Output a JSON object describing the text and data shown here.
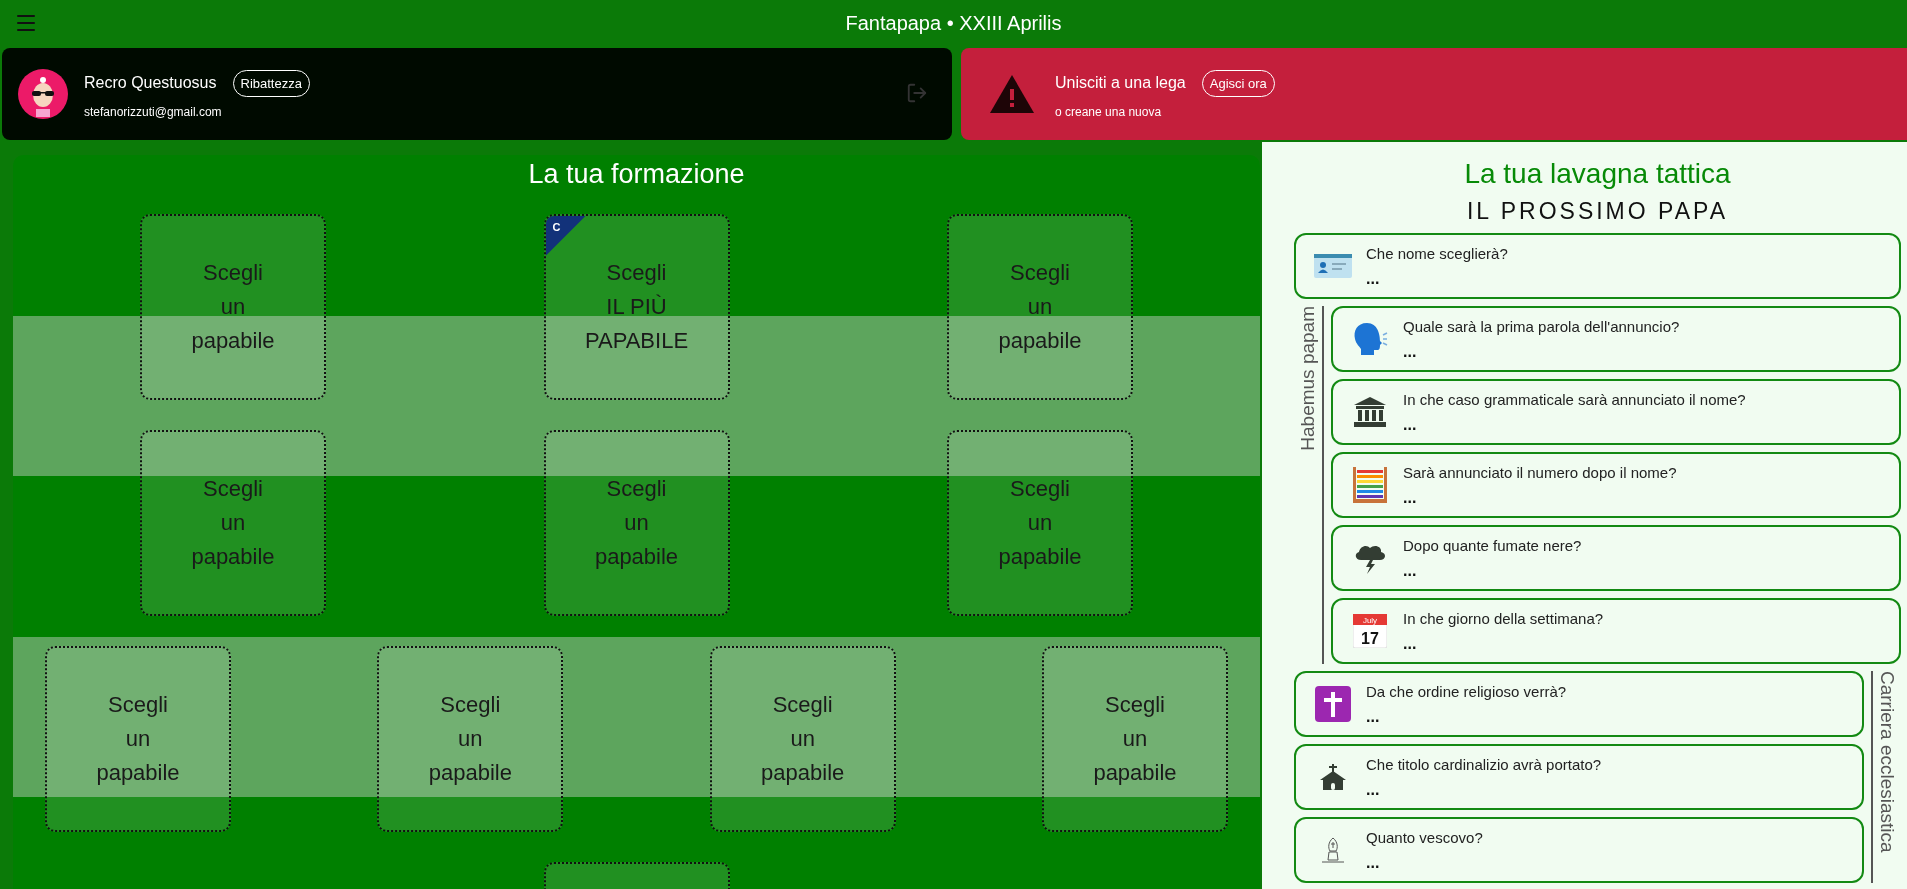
{
  "app_bar": {
    "title": "Fantapapa • XXIII Aprilis"
  },
  "user_card": {
    "name": "Recro Questuosus",
    "badge": "Ribattezza",
    "email": "stefanorizzuti@gmail.com"
  },
  "league_alert": {
    "title": "Unisciti a una lega",
    "action": "Agisci ora",
    "subtitle": "o creane una nuova"
  },
  "formation": {
    "title": "La tua formazione",
    "rows": [
      [
        {
          "text": "Scegli\nun\npapabile",
          "captain": false
        },
        {
          "text": "Scegli\nIL PIÙ\nPAPABILE",
          "captain": true,
          "badge": "C"
        },
        {
          "text": "Scegli\nun\npapabile",
          "captain": false
        }
      ],
      [
        {
          "text": "Scegli\nun\npapabile",
          "captain": false
        },
        {
          "text": "Scegli\nun\npapabile",
          "captain": false
        },
        {
          "text": "Scegli\nun\npapabile",
          "captain": false
        }
      ],
      [
        {
          "text": "Scegli\nun\npapabile",
          "captain": false
        },
        {
          "text": "Scegli\nun\npapabile",
          "captain": false
        },
        {
          "text": "Scegli\nun\npapabile",
          "captain": false
        },
        {
          "text": "Scegli\nun\npapabile",
          "captain": false
        }
      ],
      [
        {
          "captain": false
        }
      ]
    ]
  },
  "board": {
    "title": "La tua lavagna tattica",
    "subtitle": "IL PROSSIMO PAPA",
    "sections": [
      {
        "kind": "plain",
        "questions": [
          {
            "question": "Che nome sceglierà?",
            "answer": "..."
          }
        ]
      },
      {
        "kind": "label-left",
        "label": "Habemus papam",
        "questions": [
          {
            "question": "Quale sarà la prima parola dell'annuncio?",
            "answer": "..."
          },
          {
            "question": "In che caso grammaticale sarà annunciato il nome?",
            "answer": "..."
          },
          {
            "question": "Sarà annunciato il numero dopo il nome?",
            "answer": "..."
          },
          {
            "question": "Dopo quante fumate nere?",
            "answer": "..."
          },
          {
            "question": "In che giorno della settimana?",
            "answer": "...",
            "calendar": {
              "month": "July",
              "day": "17"
            }
          }
        ]
      },
      {
        "kind": "label-right",
        "label": "Carriera ecclesiastica",
        "questions": [
          {
            "question": "Da che ordine religioso verrà?",
            "answer": "..."
          },
          {
            "question": "Che titolo cardinalizio avrà portato?",
            "answer": "..."
          },
          {
            "question": "Quanto vescovo?",
            "answer": "..."
          }
        ]
      }
    ]
  }
}
